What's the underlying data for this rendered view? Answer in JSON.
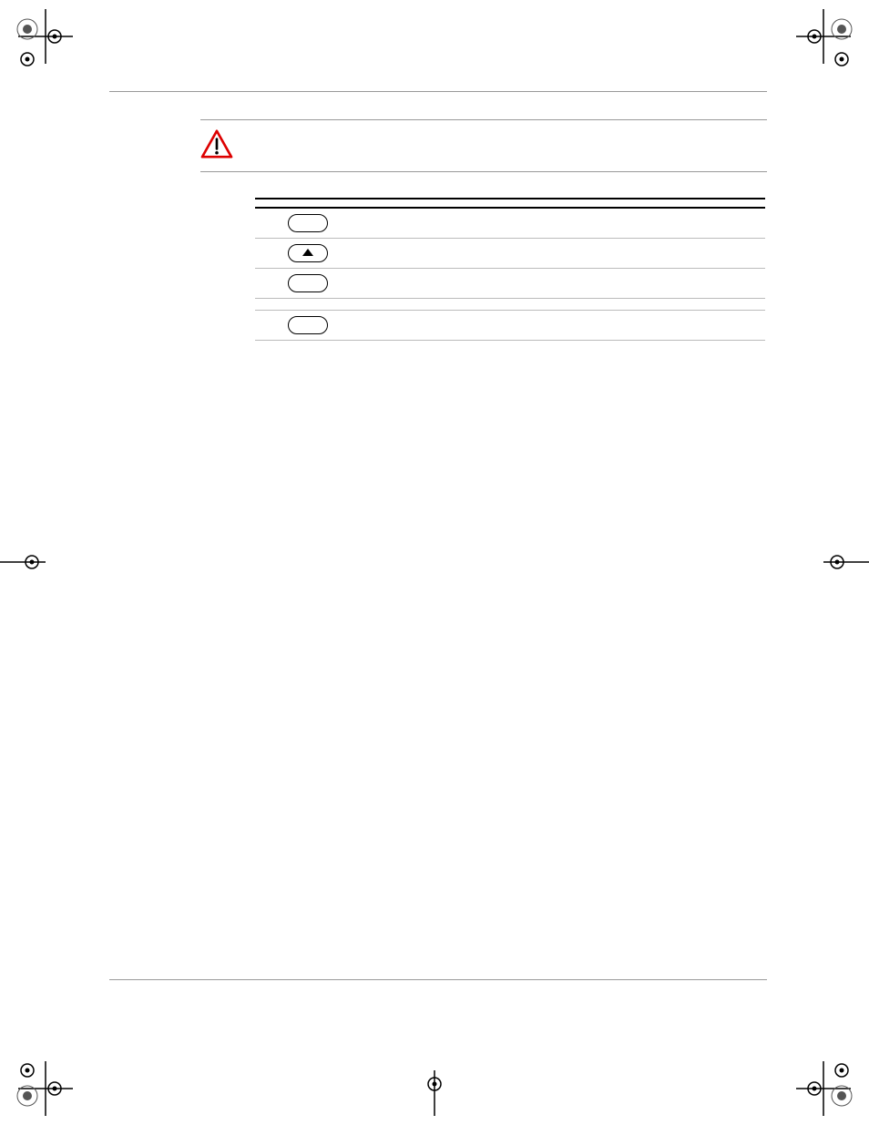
{
  "header": {
    "left": "",
    "right": ""
  },
  "intro": "",
  "caution": {
    "label": "",
    "text": ""
  },
  "section_title": "",
  "subhead": "",
  "para1": "",
  "para2": "",
  "table_title": "",
  "columns": {
    "step": "",
    "action": "",
    "result": ""
  },
  "rows": [
    {
      "step": "",
      "action_prefix": "",
      "key": "",
      "result": ""
    },
    {
      "step": "",
      "action_prefix": "",
      "key": "arrow",
      "result": ""
    },
    {
      "step": "",
      "action_prefix": "",
      "key": "",
      "result": ""
    },
    {
      "step": "",
      "action_plain": "",
      "result": ""
    },
    {
      "step": "",
      "action_prefix": "",
      "key": "",
      "result": ""
    }
  ],
  "table_note": "",
  "page_number": ""
}
